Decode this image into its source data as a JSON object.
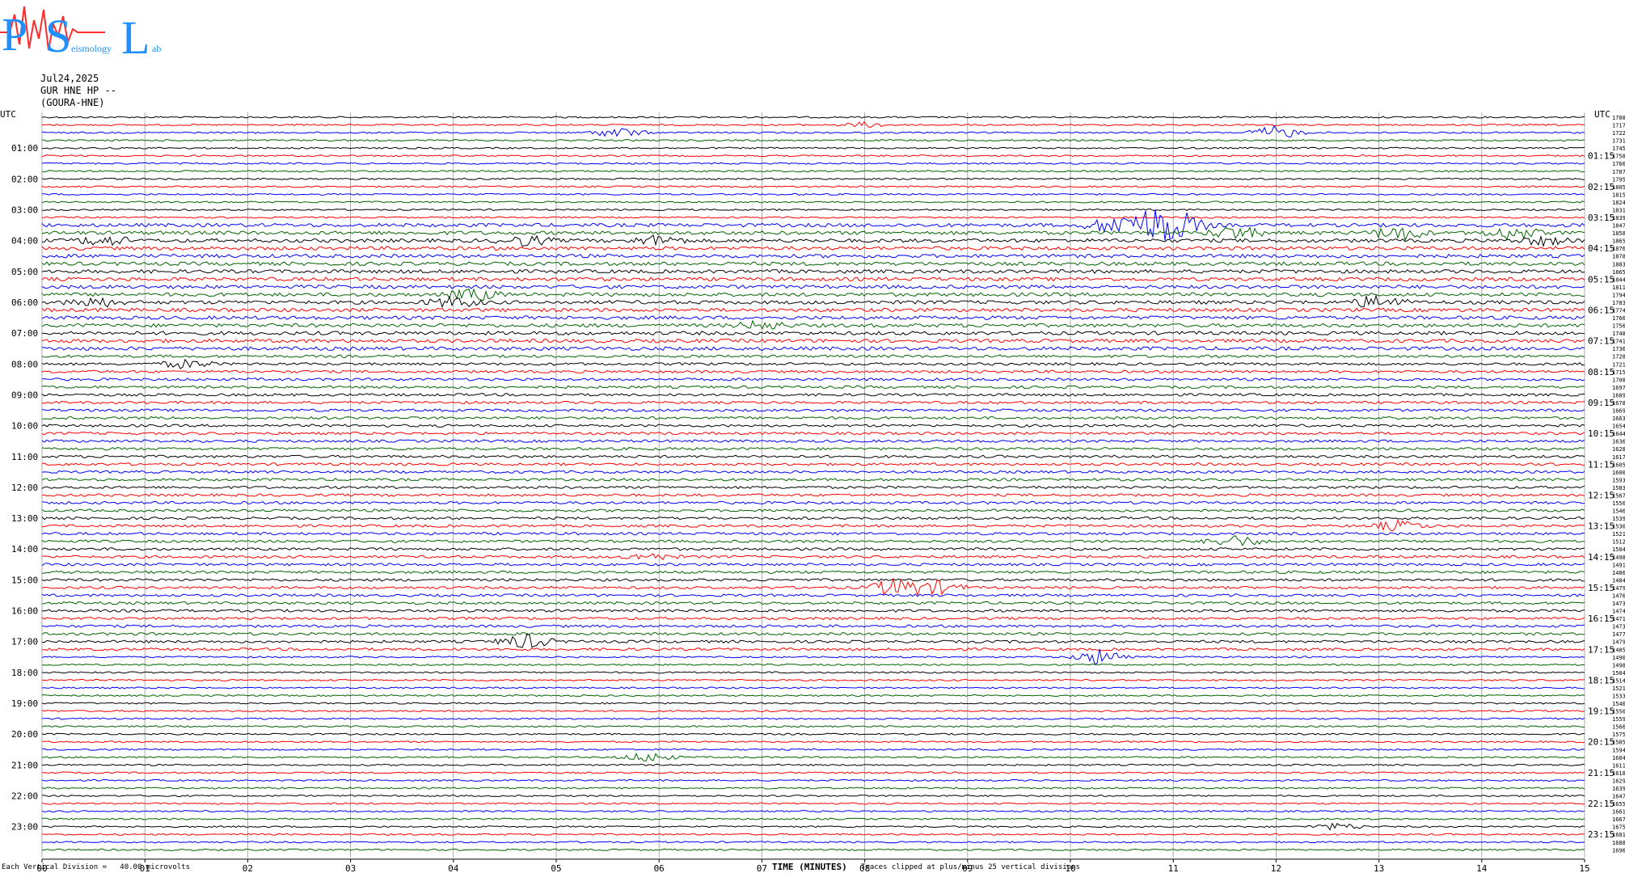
{
  "logo": {
    "letters": [
      "P",
      "S",
      "L"
    ],
    "text_parts": [
      "eismology",
      "ab"
    ]
  },
  "header": {
    "date": "Jul24,2025",
    "channel": "GUR HNE HP --",
    "station": "(GOURA-HNE)"
  },
  "colors": {
    "cycle": [
      "#000000",
      "#ff0000",
      "#0000ff",
      "#006400"
    ],
    "logo": "#1e90ff",
    "logo_trace": "#ff2a2a"
  },
  "chart_data": {
    "type": "line",
    "title": "",
    "xlabel": "TIME (MINUTES)",
    "xlim": [
      0,
      15
    ],
    "x_ticks": [
      "00",
      "01",
      "02",
      "03",
      "04",
      "05",
      "06",
      "07",
      "08",
      "09",
      "10",
      "11",
      "12",
      "13",
      "14",
      "15"
    ],
    "traces_per_hour": 4,
    "num_traces": 96,
    "left_axis_label": "UTC",
    "right_axis_label": "UTC",
    "left_hour_labels": [
      "01:00",
      "02:00",
      "03:00",
      "04:00",
      "05:00",
      "06:00",
      "07:00",
      "08:00",
      "09:00",
      "10:00",
      "11:00",
      "12:00",
      "13:00",
      "14:00",
      "15:00",
      "16:00",
      "17:00",
      "18:00",
      "19:00",
      "20:00",
      "21:00",
      "22:00",
      "23:00"
    ],
    "right_hour_labels": [
      "01:15",
      "02:15",
      "03:15",
      "04:15",
      "05:15",
      "06:15",
      "07:15",
      "08:15",
      "09:15",
      "10:15",
      "11:15",
      "12:15",
      "13:15",
      "14:15",
      "15:15",
      "16:15",
      "17:15",
      "18:15",
      "19:15",
      "20:15",
      "21:15",
      "22:15",
      "23:15"
    ],
    "trace_offsets": [
      1708,
      1717,
      1722,
      1731,
      1745,
      1758,
      1766,
      1787,
      1795,
      1805,
      1815,
      1824,
      1831,
      1839,
      1847,
      1858,
      1865,
      1876,
      1878,
      1883,
      1865,
      1844,
      1811,
      1794,
      1783,
      1774,
      1766,
      1756,
      1748,
      1741,
      1736,
      1728,
      1721,
      1715,
      1708,
      1697,
      1689,
      1678,
      1669,
      1663,
      1654,
      1644,
      1636,
      1628,
      1617,
      1605,
      1600,
      1593,
      1583,
      1567,
      1556,
      1546,
      1539,
      1530,
      1521,
      1512,
      1504,
      1498,
      1491,
      1486,
      1484,
      1479,
      1476,
      1473,
      1474,
      1471,
      1473,
      1477,
      1479,
      1485,
      1490,
      1498,
      1504,
      1514,
      1521,
      1533,
      1540,
      1550,
      1559,
      1566,
      1575,
      1585,
      1594,
      1604,
      1611,
      1618,
      1629,
      1639,
      1647,
      1655,
      1661,
      1667,
      1675,
      1681,
      1688,
      1696
    ],
    "events": [
      {
        "trace": 1,
        "minute": 8.0,
        "amp": 3
      },
      {
        "trace": 2,
        "minute": 5.6,
        "amp": 6
      },
      {
        "trace": 2,
        "minute": 12.0,
        "amp": 8
      },
      {
        "trace": 14,
        "minute": 10.4,
        "amp": 9
      },
      {
        "trace": 14,
        "minute": 10.7,
        "amp": 12
      },
      {
        "trace": 14,
        "minute": 10.9,
        "amp": 14
      },
      {
        "trace": 14,
        "minute": 11.1,
        "amp": 10
      },
      {
        "trace": 15,
        "minute": 11.6,
        "amp": 8
      },
      {
        "trace": 15,
        "minute": 13.2,
        "amp": 9
      },
      {
        "trace": 15,
        "minute": 14.3,
        "amp": 8
      },
      {
        "trace": 16,
        "minute": 0.6,
        "amp": 6
      },
      {
        "trace": 16,
        "minute": 4.7,
        "amp": 6
      },
      {
        "trace": 16,
        "minute": 6.0,
        "amp": 6
      },
      {
        "trace": 16,
        "minute": 14.6,
        "amp": 5
      },
      {
        "trace": 23,
        "minute": 4.2,
        "amp": 7
      },
      {
        "trace": 24,
        "minute": 0.5,
        "amp": 6
      },
      {
        "trace": 24,
        "minute": 4.0,
        "amp": 6
      },
      {
        "trace": 24,
        "minute": 13.0,
        "amp": 8
      },
      {
        "trace": 27,
        "minute": 7.0,
        "amp": 5
      },
      {
        "trace": 32,
        "minute": 1.4,
        "amp": 5
      },
      {
        "trace": 53,
        "minute": 13.2,
        "amp": 6
      },
      {
        "trace": 55,
        "minute": 11.6,
        "amp": 7
      },
      {
        "trace": 57,
        "minute": 5.9,
        "amp": 4
      },
      {
        "trace": 61,
        "minute": 8.3,
        "amp": 11
      },
      {
        "trace": 61,
        "minute": 8.7,
        "amp": 8
      },
      {
        "trace": 68,
        "minute": 4.7,
        "amp": 9
      },
      {
        "trace": 70,
        "minute": 10.3,
        "amp": 10
      },
      {
        "trace": 83,
        "minute": 5.9,
        "amp": 6
      },
      {
        "trace": 92,
        "minute": 12.6,
        "amp": 4
      }
    ],
    "note": "Traces clipped at plus/minus 25 vertical divisions",
    "scale_note": "Each Vertical Division =   40.00 microvolts"
  }
}
